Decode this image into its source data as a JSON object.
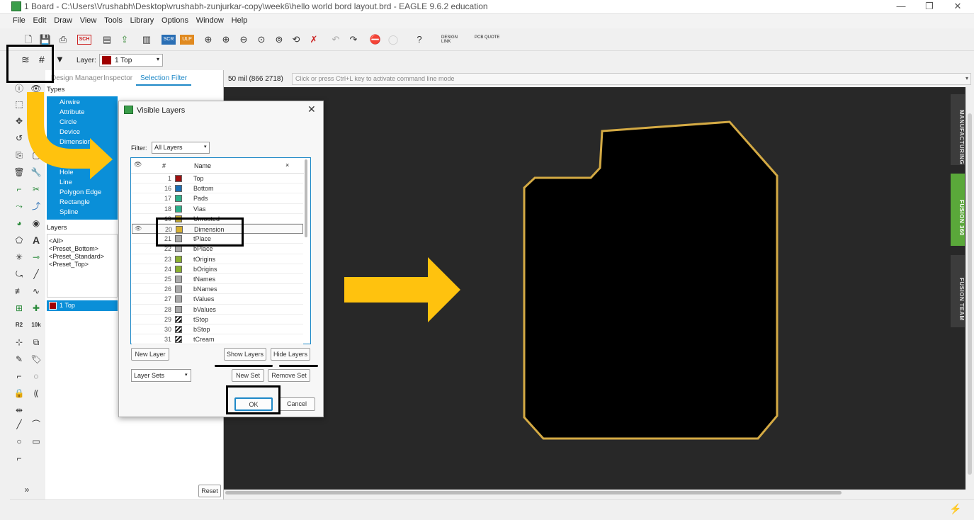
{
  "window": {
    "title": "1 Board - C:\\Users\\Vrushabh\\Desktop\\vrushabh-zunjurkar-copy\\week6\\hello world bord layout.brd - EAGLE 9.6.2 education",
    "min": "—",
    "max": "❐",
    "close": "✕"
  },
  "menu": [
    "File",
    "Edit",
    "Draw",
    "View",
    "Tools",
    "Library",
    "Options",
    "Window",
    "Help"
  ],
  "toolbar": {
    "design_link": "DESIGN LINK",
    "pcb_quote": "PCB QUOTE",
    "sch": "SCH",
    "ulp": "ULP",
    "scr": "SCR",
    "help": "?"
  },
  "layerbar": {
    "label": "Layer:",
    "value": "1 Top",
    "color": "#a00000"
  },
  "panel": {
    "tabs": [
      "Design Manager",
      "Inspector",
      "Selection Filter"
    ],
    "types_header": "Types",
    "types": [
      "Airwire",
      "Attribute",
      "Circle",
      "Device",
      "Dimension",
      "Hole",
      "Line",
      "Polygon Edge",
      "Rectangle",
      "Spline"
    ],
    "layers_header": "Layers",
    "layer_sets": [
      "<All>",
      "<Preset_Bottom>",
      "<Preset_Standard>",
      "<Preset_Top>"
    ],
    "selected_layer": "1 Top",
    "reset": "Reset"
  },
  "coord": {
    "readout": "50 mil (866 2718)",
    "command_placeholder": "Click or press Ctrl+L key to activate command line mode"
  },
  "sidetabs": [
    "MANUFACTURING",
    "FUSION 360",
    "FUSION TEAM"
  ],
  "dialog": {
    "title": "Visible Layers",
    "filter_label": "Filter:",
    "filter_value": "All Layers",
    "col_num": "#",
    "col_name": "Name",
    "col_x": "×",
    "layers": [
      {
        "num": "1",
        "name": "Top",
        "color": "#a01010"
      },
      {
        "num": "16",
        "name": "Bottom",
        "color": "#1a6fb5"
      },
      {
        "num": "17",
        "name": "Pads",
        "color": "#2bb08a"
      },
      {
        "num": "18",
        "name": "Vias",
        "color": "#2bb08a"
      },
      {
        "num": "19",
        "name": "Unrouted",
        "color": "#b8a030"
      },
      {
        "num": "20",
        "name": "Dimension",
        "color": "#d7b030"
      },
      {
        "num": "21",
        "name": "tPlace",
        "color": "#aaaaaa"
      },
      {
        "num": "22",
        "name": "bPlace",
        "color": "#aaaaaa"
      },
      {
        "num": "23",
        "name": "tOrigins",
        "color": "#8bb030"
      },
      {
        "num": "24",
        "name": "bOrigins",
        "color": "#8bb030"
      },
      {
        "num": "25",
        "name": "tNames",
        "color": "#aaaaaa"
      },
      {
        "num": "26",
        "name": "bNames",
        "color": "#aaaaaa"
      },
      {
        "num": "27",
        "name": "tValues",
        "color": "#aaaaaa"
      },
      {
        "num": "28",
        "name": "bValues",
        "color": "#aaaaaa"
      },
      {
        "num": "29",
        "name": "tStop",
        "color": "#333333"
      },
      {
        "num": "30",
        "name": "bStop",
        "color": "#333333"
      },
      {
        "num": "31",
        "name": "tCream",
        "color": "#333333"
      }
    ],
    "new_layer": "New Layer",
    "show_layers": "Show Layers",
    "hide_layers": "Hide Layers",
    "layer_sets": "Layer Sets",
    "new_set": "New Set",
    "remove_set": "Remove Set",
    "ok": "OK",
    "cancel": "Cancel"
  },
  "colors": {
    "accent": "#1e88c7",
    "selection": "#0a8fd8",
    "canvas": "#282828",
    "board_outline": "#d4aa44",
    "arrow": "#ffc20e"
  }
}
